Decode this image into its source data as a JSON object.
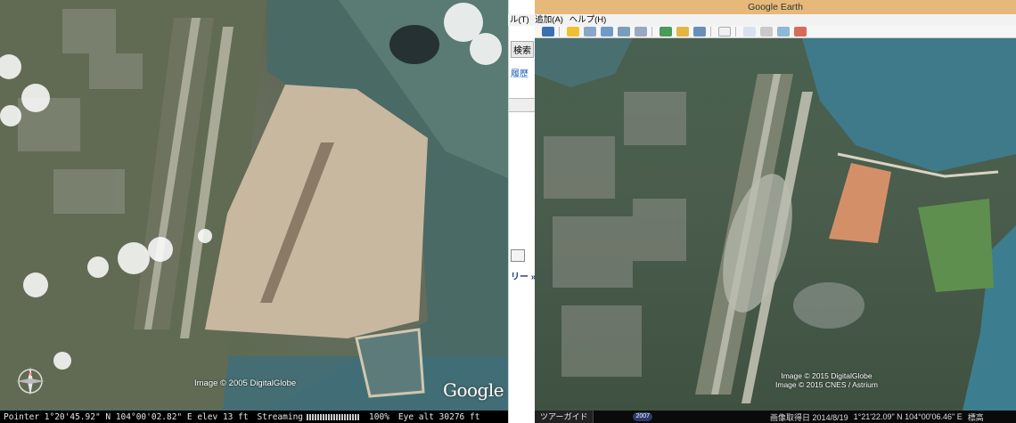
{
  "left_panel": {
    "status": {
      "pointer": "Pointer  1°20'45.92\" N  104°00'02.82\" E  elev  13 ft",
      "streaming_label": "Streaming",
      "streaming_value": "100%",
      "eye_alt": "Eye alt  30276 ft"
    },
    "copyright": "Image © 2005 DigitalGlobe",
    "logo": "Google",
    "compass_letter": "N"
  },
  "middle_sidebar": {
    "search_label": "検索",
    "history_label": "履歴",
    "tree_label": "リー »"
  },
  "right_window": {
    "title": "Google Earth",
    "menu": [
      "ル(T)",
      "追加(A)",
      "ヘルプ(H)"
    ],
    "copyright_lines": [
      "Image © 2015 DigitalGlobe",
      "Image © 2015 CNES / Astrium"
    ],
    "status": {
      "tour_label": "ツアーガイド",
      "history_year": "2007",
      "capture_date": "画像取得日 2014/8/19",
      "coords": "1°21'22.09\" N 104°00'06.46\" E",
      "elevation_label": "標高"
    }
  },
  "colors": {
    "title_bar": "#e6b97a",
    "link": "#1a5fb4"
  }
}
